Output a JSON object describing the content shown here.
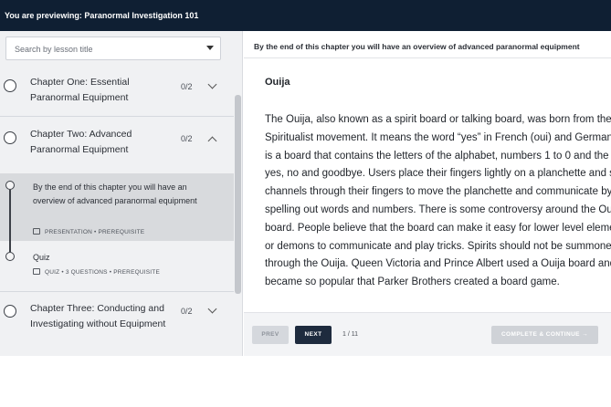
{
  "topbar": {
    "preview_text": "You are previewing: Paranormal Investigation 101"
  },
  "sidebar": {
    "search_placeholder": "Search by lesson title",
    "chapters": [
      {
        "title": "Chapter One: Essential Paranormal Equipment",
        "progress": "0/2",
        "expanded": false
      },
      {
        "title": "Chapter Two: Advanced Paranormal Equipment",
        "progress": "0/2",
        "expanded": true,
        "lessons": [
          {
            "title": "By the end of this chapter you will have an overview of advanced paranormal equipment",
            "meta": "PRESENTATION • PREREQUISITE",
            "active": true
          },
          {
            "title": "Quiz",
            "meta": "QUIZ • 3 QUESTIONS • PREREQUISITE",
            "active": false
          }
        ]
      },
      {
        "title": "Chapter Three: Conducting and Investigating without Equipment",
        "progress": "0/2",
        "expanded": false
      }
    ]
  },
  "content": {
    "header": "By the end of this chapter you will have an overview of advanced paranormal equipment",
    "title": "Ouija",
    "body": "The Ouija, also known as a spirit board or talking board, was born from the Spiritualist movement. It means the word “yes” in French (oui) and German (ja). It is a board that contains the letters of the alphabet, numbers 1 to 0 and the words yes, no and goodbye. Users place their fingers lightly on a planchette and spirit channels through their fingers to move the planchette and communicate by spelling out words and numbers. There is some controversy around the Ouija board. People believe that the board can make it easy for lower level elementals or demons to communicate and play tricks. Spirits should not be summoned through the Ouija. Queen Victoria and Prince Albert used a Ouija board and it became so popular that Parker Brothers created a board game."
  },
  "footer": {
    "prev_label": "PREV",
    "next_label": "NEXT",
    "page_indicator": "1 / 11",
    "complete_label": "COMPLETE & CONTINUE →"
  }
}
